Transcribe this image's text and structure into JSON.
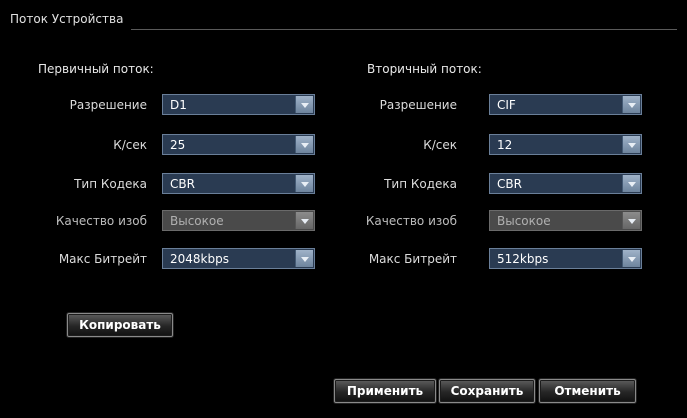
{
  "group": {
    "title": "Поток Устройства"
  },
  "primary": {
    "title": "Первичный поток:",
    "rows": [
      {
        "label": "Разрешение",
        "value": "D1",
        "enabled": true
      },
      {
        "label": "К/сек",
        "value": "25",
        "enabled": true
      },
      {
        "label": "Тип Кодека",
        "value": "CBR",
        "enabled": true
      },
      {
        "label": "Качество изоб",
        "value": "Высокое",
        "enabled": false
      },
      {
        "label": "Макс Битрейт",
        "value": "2048kbps",
        "enabled": true
      }
    ]
  },
  "secondary": {
    "title": "Вторичный поток:",
    "rows": [
      {
        "label": "Разрешение",
        "value": "CIF",
        "enabled": true
      },
      {
        "label": "К/сек",
        "value": "12",
        "enabled": true
      },
      {
        "label": "Тип Кодека",
        "value": "CBR",
        "enabled": true
      },
      {
        "label": "Качество изоб",
        "value": "Высокое",
        "enabled": false
      },
      {
        "label": "Макс Битрейт",
        "value": "512kbps",
        "enabled": true
      }
    ]
  },
  "buttons": {
    "copy": "Копировать",
    "apply": "Применить",
    "save": "Сохранить",
    "cancel": "Отменить"
  }
}
